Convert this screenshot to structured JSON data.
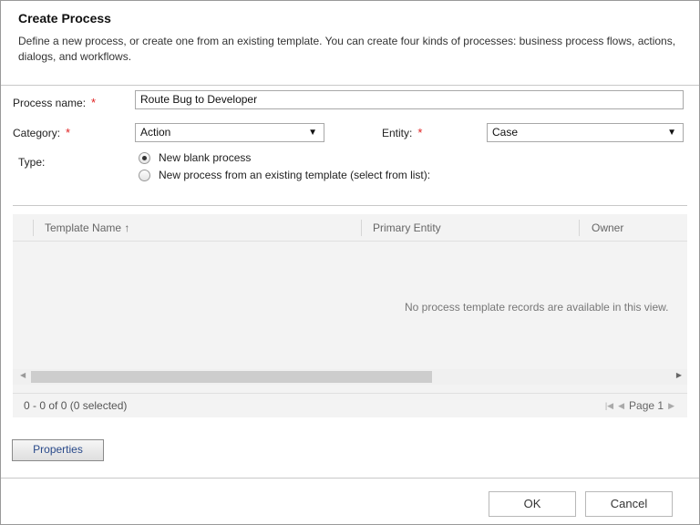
{
  "dialog": {
    "title": "Create Process",
    "description": "Define a new process, or create one from an existing template. You can create four kinds of processes: business process flows, actions, dialogs, and workflows."
  },
  "form": {
    "process_name_label": "Process name:",
    "process_name_value": "Route Bug to Developer",
    "category_label": "Category:",
    "category_value": "Action",
    "entity_label": "Entity:",
    "entity_value": "Case",
    "type_label": "Type:",
    "required_marker": "*",
    "type_options": [
      {
        "label": "New blank process",
        "selected": true
      },
      {
        "label": "New process from an existing template (select from list):",
        "selected": false
      }
    ]
  },
  "grid": {
    "columns": [
      "Template Name ↑",
      "Primary Entity",
      "Owner"
    ],
    "empty_message": "No process template records are available in this view.",
    "record_count": "0 - 0 of 0 (0 selected)",
    "page_label": "Page 1"
  },
  "buttons": {
    "properties": "Properties",
    "ok": "OK",
    "cancel": "Cancel"
  }
}
